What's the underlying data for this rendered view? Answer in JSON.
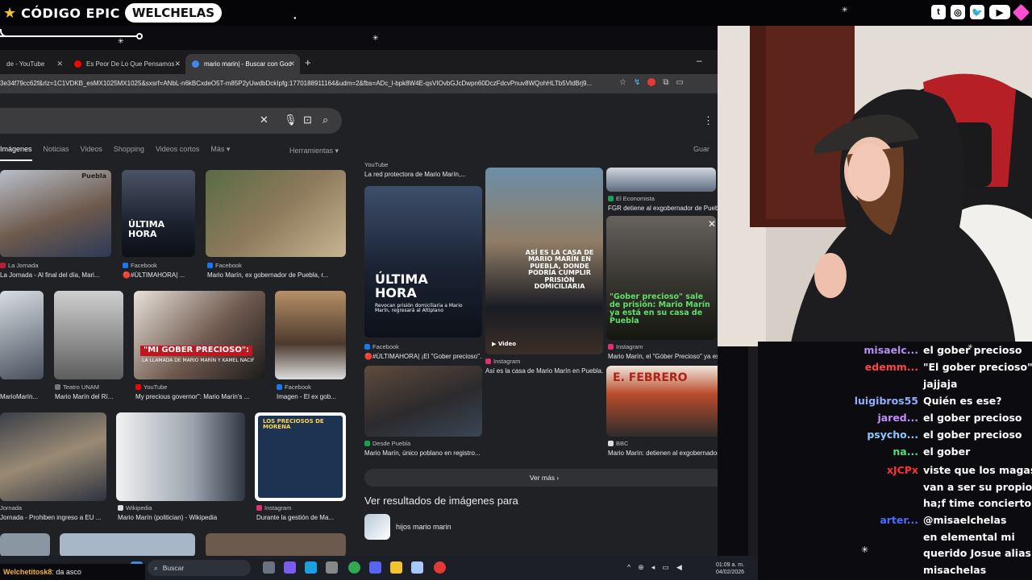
{
  "overlay": {
    "brand_code": "CÓDIGO EPIC",
    "brand_name": "WELCHELAS",
    "social": [
      "twitch-icon",
      "instagram-icon",
      "twitter-icon",
      "youtube-icon",
      "gem-icon"
    ]
  },
  "browser": {
    "tabs": [
      {
        "label": "de - YouTube",
        "color": "#ff0000"
      },
      {
        "label": "Es Peor De Lo Que Pensamos -",
        "color": "#ff0000"
      },
      {
        "label": "mario marin| - Buscar con Goo",
        "color": "#4285f4"
      }
    ],
    "url": "3e34f79cc62f&rlz=1C1VDKB_esMX1025MX1025&sxsrf=ANbL-n6kBCxdeO5T-m85P2yUwdbDckIpfg:1770188911164&udm=2&fbs=ADc_l-bpk8W4E-qsVIOvbGJcDwpn60DczFdcvPnuv8WQohHLTb5VldBrj9..."
  },
  "google": {
    "tabs": [
      "Imágenes",
      "Noticias",
      "Videos",
      "Shopping",
      "Videos cortos",
      "Más ▾"
    ],
    "tools": "Herramientas ▾",
    "saved": "Guar",
    "results": [
      {
        "source": "La Jornada",
        "caption": "La Jornada - Al final del día, Mari...",
        "color": "#b81e3a"
      },
      {
        "source": "Facebook",
        "caption": "🔴#ÚLTIMAHORA| ...",
        "color": "#1877f2"
      },
      {
        "source": "Facebook",
        "caption": "Mario Marín, ex gobernador de Puebla, r...",
        "color": "#1877f2"
      },
      {
        "source": "",
        "caption": "MarioMarín...",
        "color": "#555"
      },
      {
        "source": "Teatro UNAM",
        "caption": "Mario Marín del Rí...",
        "color": "#777"
      },
      {
        "source": "YouTube",
        "caption": "My precious governor\": Mario Marín's ...",
        "color": "#ff0000"
      },
      {
        "source": "Facebook",
        "caption": "Imagen - El ex gob...",
        "color": "#1877f2"
      },
      {
        "source": "Jornada",
        "caption": "Jornada - Prohiben ingreso a EU ...",
        "color": "#b81e3a"
      },
      {
        "source": "Wikipedia",
        "caption": "Mario Marín (politician) - Wikipedia",
        "color": "#ddd"
      },
      {
        "source": "Instagram",
        "caption": "Durante la gestión de Ma...",
        "color": "#e1306c"
      }
    ],
    "img_texts": {
      "ultima": "ÚLTIMA HORA",
      "ultima_sub": "Revocan prisión domiciliaria a Mario Marín, regresará al Altiplano",
      "gober": "\"MI GOBER PRECIOSO\":",
      "gober_sub": "LA LLAMADA DE MARIO MARÍN Y KAMEL NACIF",
      "preciosos": "LOS PRECIOSOS DE MORENA",
      "casa": "ASÍ ES LA CASA DE MARIO MARÍN EN PUEBLA, DONDE PODRÍA CUMPLIR PRISIÓN DOMICILIARIA",
      "sale": "\"Gober precioso\" sale de prisión: Mario Marín ya está en su casa de Puebla",
      "febrero": "E. FEBRERO",
      "video": "▶ Video",
      "puebla": "Puebla"
    },
    "panel": {
      "top_source": "YouTube",
      "top_caption": "La red protectora de Mario Marín,...",
      "economista_source": "El Economista",
      "economista_caption": "FGR detiene al exgobernador de Puebl...",
      "items": [
        {
          "source": "Facebook",
          "caption": "🔴#ÚLTIMAHORA| ¡El \"Gober precioso\"...",
          "color": "#1877f2"
        },
        {
          "source": "Instagram",
          "caption": "Así es la casa de Mario Marín en Puebla...",
          "color": "#e1306c"
        },
        {
          "source": "Instagram",
          "caption": "Mario Marín, el \"Góber Precioso\" ya es...",
          "color": "#e1306c"
        },
        {
          "source": "Desde Puebla",
          "caption": "Mario Marín, único poblano en registro...",
          "color": "#1a9e5a"
        },
        {
          "source": "BBC",
          "caption": "Mario Marín: detienen al exgobernador...",
          "color": "#ddd"
        }
      ],
      "ver_mas": "Ver más  ›",
      "ver_resultados": "Ver resultados de imágenes para",
      "related": "hijos mario marin"
    }
  },
  "taskbar": {
    "search_placeholder": "Buscar",
    "time": "01:09 a. m.",
    "date": "04/02/2026"
  },
  "ticker": {
    "user": "Welchetitosk8",
    "text": ": da asco"
  },
  "chat": [
    {
      "user": "misaelc...",
      "color": "#b88ef2",
      "text": "el gober precioso"
    },
    {
      "user": "edemm...",
      "color": "#ff4444",
      "text": "\"El gober precioso\""
    },
    {
      "user": "",
      "color": "#fff",
      "text": "jajjaja"
    },
    {
      "user": "luigibros55",
      "color": "#8fb0ff",
      "text": "Quién es ese?"
    },
    {
      "user": "jared...",
      "color": "#c38cff",
      "text": "el gober precioso"
    },
    {
      "user": "psycho...",
      "color": "#8ec7ff",
      "text": "el gober precioso"
    },
    {
      "user": "na...",
      "color": "#4fe07a",
      "text": "el gober"
    },
    {
      "user": "xJCPx",
      "color": "#ff3030",
      "text": "viste que los magas"
    },
    {
      "user": "",
      "color": "#fff",
      "text": "van a ser su propio"
    },
    {
      "user": "",
      "color": "#fff",
      "text": "ha;f time concierto"
    },
    {
      "user": "arter...",
      "color": "#4d6bff",
      "text": "@misaelchelas"
    },
    {
      "user": "",
      "color": "#fff",
      "text": "en elemental mi"
    },
    {
      "user": "",
      "color": "#fff",
      "text": "querido Josue alias"
    },
    {
      "user": "",
      "color": "#fff",
      "text": "misachelas"
    }
  ]
}
